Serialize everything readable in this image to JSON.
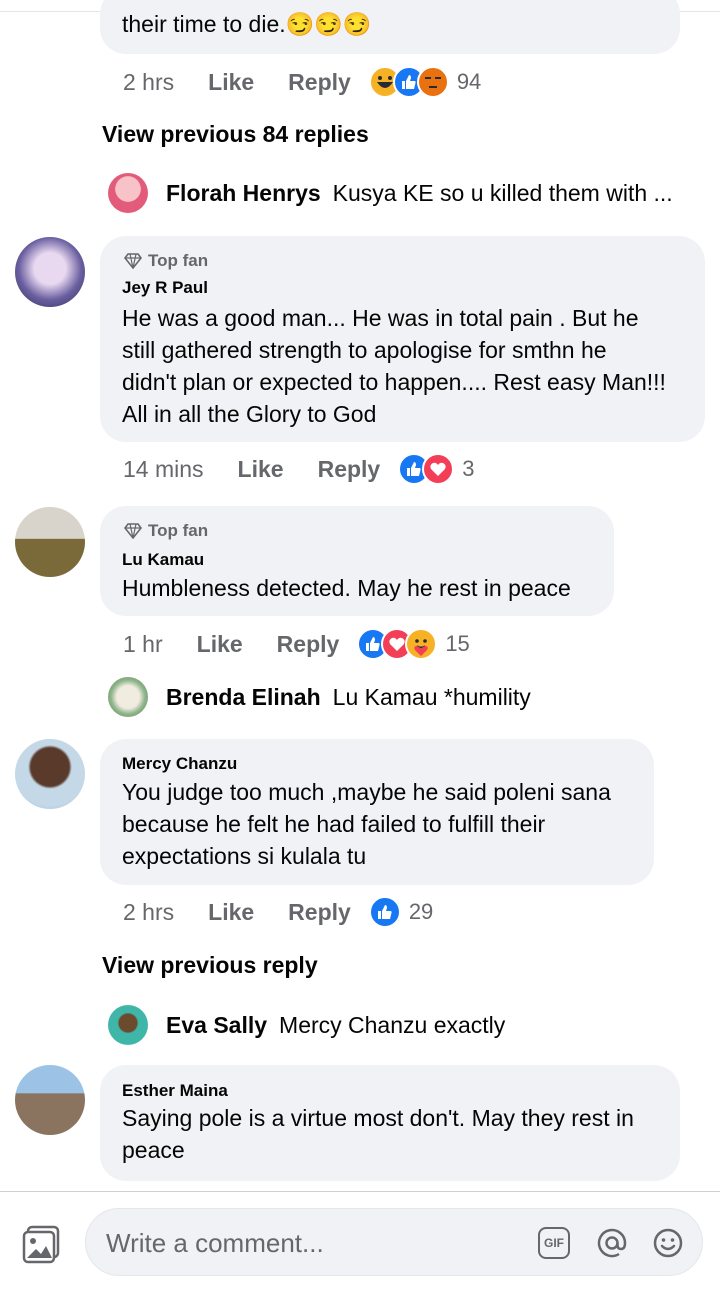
{
  "top": {
    "partial_text": "their time to die.😏😏😏",
    "time": "2 hrs",
    "like": "Like",
    "reply": "Reply",
    "reaction_count": "94"
  },
  "view_previous_1": "View previous 84 replies",
  "reply1": {
    "name": "Florah Henrys",
    "text": "Kusya KE so u killed them with ..."
  },
  "comment1": {
    "badge": "Top fan",
    "author": "Jey R Paul",
    "lines": [
      "He was a good man... He was in total pain . But he",
      "still gathered strength to apologise for smthn he",
      "didn't plan or expected to happen.... Rest easy Man!!!",
      "All in all the Glory to God"
    ],
    "time": "14 mins",
    "like": "Like",
    "reply": "Reply",
    "reaction_count": "3"
  },
  "comment2": {
    "badge": "Top fan",
    "author": "Lu Kamau",
    "lines": [
      "Humbleness detected. May he rest in peace"
    ],
    "time": "1 hr",
    "like": "Like",
    "reply": "Reply",
    "reaction_count": "15"
  },
  "reply2": {
    "name": "Brenda Elinah",
    "text": "Lu Kamau *humility"
  },
  "comment3": {
    "author": "Mercy Chanzu",
    "lines": [
      "You judge too much ,maybe he said poleni sana",
      "because he felt he had failed to fulfill their",
      "expectations si kulala tu"
    ],
    "time": "2 hrs",
    "like": "Like",
    "reply": "Reply",
    "reaction_count": "29"
  },
  "view_previous_2": "View previous reply",
  "reply3": {
    "name": "Eva Sally",
    "text": "Mercy Chanzu exactly"
  },
  "comment4": {
    "author": "Esther Maina",
    "lines": [
      "Saying pole is a virtue most don't. May they rest in",
      "peace"
    ]
  },
  "composer": {
    "placeholder": "Write a comment...",
    "gif": "GIF"
  },
  "colors": {
    "accent": "#1877f2",
    "bubble": "#f0f2f5",
    "meta": "#65676b"
  }
}
